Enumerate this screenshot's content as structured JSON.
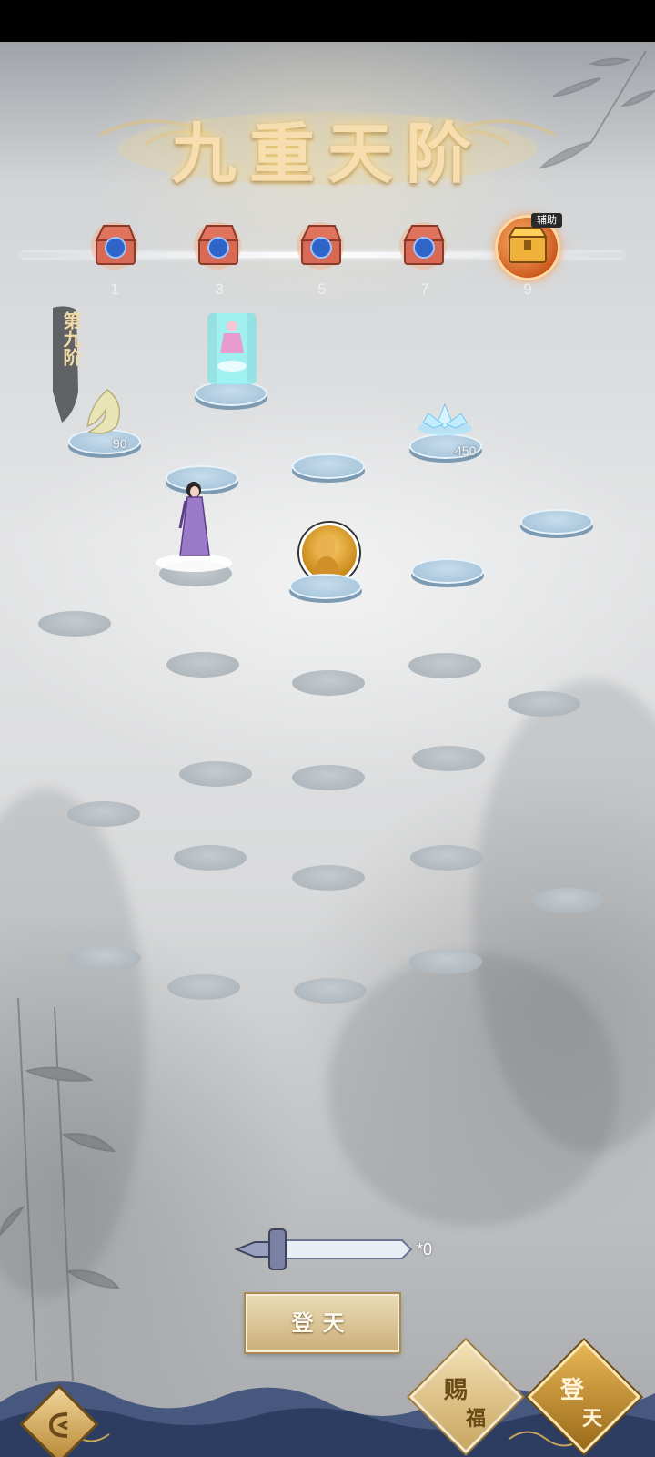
{
  "title": "九重天阶",
  "level_tag": "第九阶",
  "milestones": [
    "1",
    "3",
    "5",
    "7",
    "9"
  ],
  "assist_tag": "辅助",
  "rewards": {
    "left_amount": "90",
    "right_amount": "450"
  },
  "sword": {
    "count": "*0"
  },
  "buttons": {
    "ascend": "登天",
    "bless_top": "赐",
    "bless_bottom": "福",
    "heaven_top": "登",
    "heaven_bottom": "天"
  },
  "icons": {
    "chest": "treasure-chest-icon",
    "gold_chest": "gold-chest-icon",
    "feather": "feather-wind-icon",
    "lotus": "ice-lotus-icon",
    "sword": "sword-icon",
    "back": "back-icon"
  },
  "colors": {
    "gold": "#f6deb0",
    "step": "#b3bbc1",
    "active_step": "#a9c6dc"
  }
}
